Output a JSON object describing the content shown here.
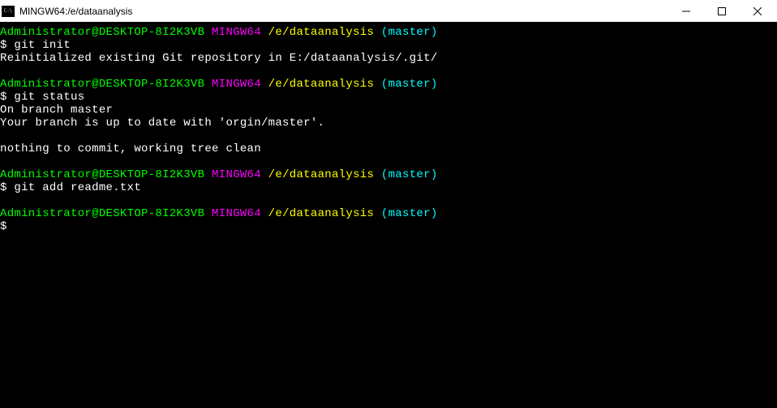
{
  "title": "MINGW64:/e/dataanalysis",
  "prompt": {
    "user_host": "Administrator@DESKTOP-8I2K3VB",
    "shell": "MINGW64",
    "path": "/e/dataanalysis",
    "branch": "(master)",
    "symbol": "$"
  },
  "blocks": [
    {
      "command": " git init",
      "output": [
        "Reinitialized existing Git repository in E:/dataanalysis/.git/"
      ]
    },
    {
      "command": " git status",
      "output": [
        "On branch master",
        "Your branch is up to date with 'orgin/master'.",
        "",
        "nothing to commit, working tree clean"
      ]
    },
    {
      "command": " git add readme.txt",
      "output": []
    },
    {
      "command": "",
      "output": []
    }
  ]
}
